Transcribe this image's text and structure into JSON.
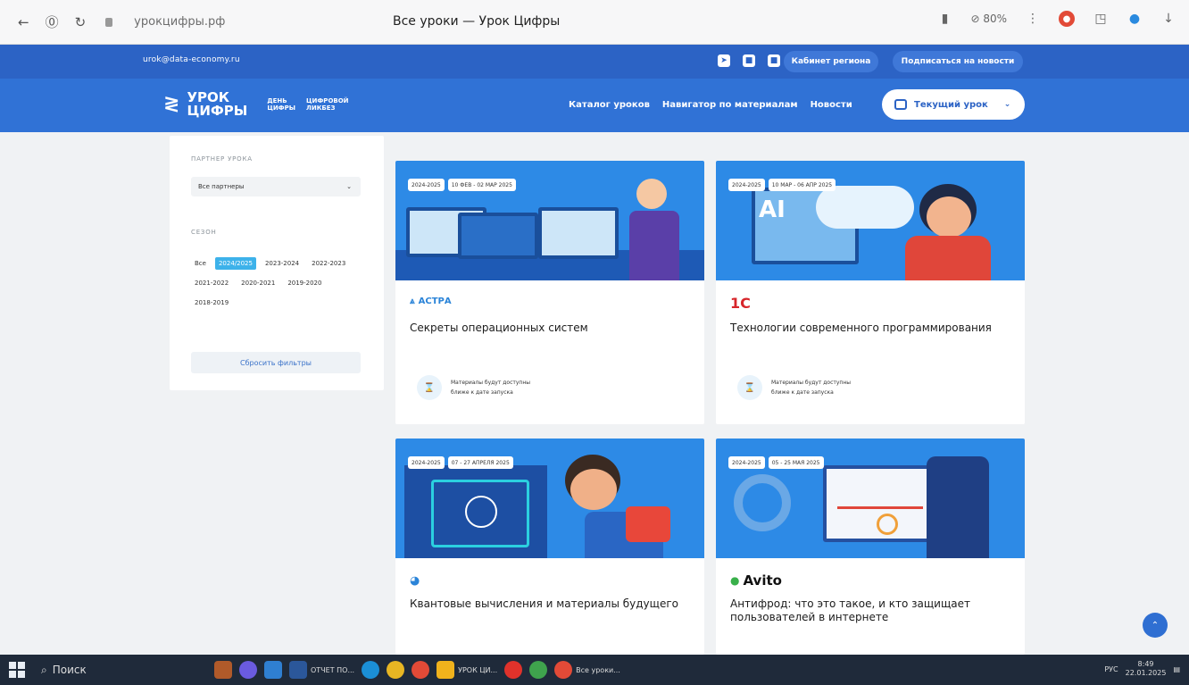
{
  "browser": {
    "url": "урокцифры.рф",
    "tab_title": "Все уроки — Урок Цифры",
    "zoom": "80%"
  },
  "topbar": {
    "email": "urok@data-economy.ru",
    "region_button": "Кабинет региона",
    "subscribe_button": "Подписаться на новости"
  },
  "header": {
    "logo_line1": "УРОК",
    "logo_line2": "ЦИФРЫ",
    "sub1_line1": "ДЕНЬ",
    "sub1_line2": "ЦИФРЫ",
    "sub2_line1": "ЦИФРОВОЙ",
    "sub2_line2": "ЛИКБЕЗ",
    "menu": [
      "Каталог уроков",
      "Навигатор по материалам",
      "Новости"
    ],
    "current_lesson": "Текущий урок"
  },
  "sidebar": {
    "partner_label": "ПАРТНЕР УРОКА",
    "partner_value": "Все партнеры",
    "season_label": "СЕЗОН",
    "seasons": [
      "Все",
      "2024/2025",
      "2023-2024",
      "2022-2023",
      "2021-2022",
      "2020-2021",
      "2019-2020",
      "2018-2019"
    ],
    "reset": "Сбросить фильтры"
  },
  "cards": [
    {
      "season": "2024-2025",
      "dates": "10 ФЕВ - 02 МАР 2025",
      "partner": "АСТРА",
      "title": "Секреты операционных систем",
      "avail_line1": "Материалы будут доступны",
      "avail_line2": "ближе к дате запуска"
    },
    {
      "season": "2024-2025",
      "dates": "10 МАР - 06 АПР 2025",
      "partner": "1С",
      "title": "Технологии современного программирования",
      "avail_line1": "Материалы будут доступны",
      "avail_line2": "ближе к дате запуска"
    },
    {
      "season": "2024-2025",
      "dates": "07 - 27 АПРЕЛЯ 2025",
      "partner": "",
      "title": "Квантовые вычисления и материалы будущего"
    },
    {
      "season": "2024-2025",
      "dates": "05 - 25 МАЯ 2025",
      "partner": "Avito",
      "title": "Антифрод: что это такое, и кто защищает пользователей в интернете"
    }
  ],
  "taskbar": {
    "search": "Поиск",
    "app1": "ОТЧЕТ ПО...",
    "app2": "УРОК ЦИ...",
    "app3": "Все уроки...",
    "lang": "РУС",
    "time": "8:49",
    "date": "22.01.2025"
  },
  "colors": {
    "brand": "#3072d6",
    "topbar": "#2c63c5",
    "accent": "#3db2ea"
  }
}
